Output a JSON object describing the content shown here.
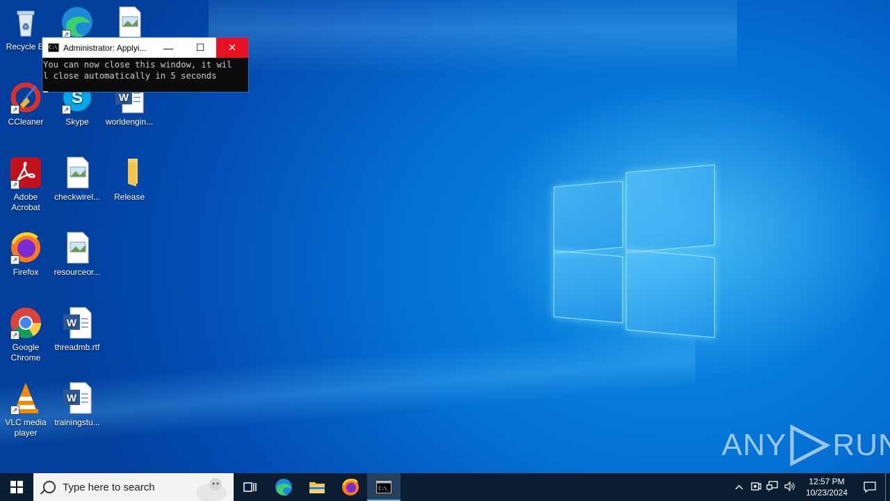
{
  "desktop": {
    "icons": [
      {
        "label": "Recycle Bin",
        "short": "Recycle Bi",
        "kind": "recycle"
      },
      {
        "label": "",
        "kind": "edge"
      },
      {
        "label": "",
        "kind": "image-file"
      },
      {
        "label": "CCleaner",
        "kind": "ccleaner"
      },
      {
        "label": "Skype",
        "kind": "skype"
      },
      {
        "label": "worldengin...",
        "kind": "word"
      },
      {
        "label": "Adobe Acrobat",
        "kind": "acrobat"
      },
      {
        "label": "checkwirel...",
        "kind": "image-file"
      },
      {
        "label": "Release",
        "kind": "folder"
      },
      {
        "label": "Firefox",
        "kind": "firefox"
      },
      {
        "label": "resourceor...",
        "kind": "image-file"
      },
      {
        "label": "Google Chrome",
        "kind": "chrome"
      },
      {
        "label": "threadmb.rtf",
        "kind": "word"
      },
      {
        "label": "VLC media player",
        "kind": "vlc"
      },
      {
        "label": "trainingstu...",
        "kind": "word"
      }
    ]
  },
  "cmd_window": {
    "title": "Administrator: Applyi...",
    "line1": "You can now close this window, it wil",
    "line2": "l close automatically in 5 seconds",
    "minimize": "—",
    "maximize": "☐",
    "close": "✕"
  },
  "watermark": {
    "text_left": "ANY",
    "text_right": "RUN"
  },
  "taskbar": {
    "search_placeholder": "Type here to search",
    "clock_time": "12:57 PM",
    "clock_date": "10/23/2024"
  },
  "colors": {
    "taskbar": "#0b1e31",
    "close_red": "#e81123",
    "desktop_blue": "#0470d3"
  }
}
